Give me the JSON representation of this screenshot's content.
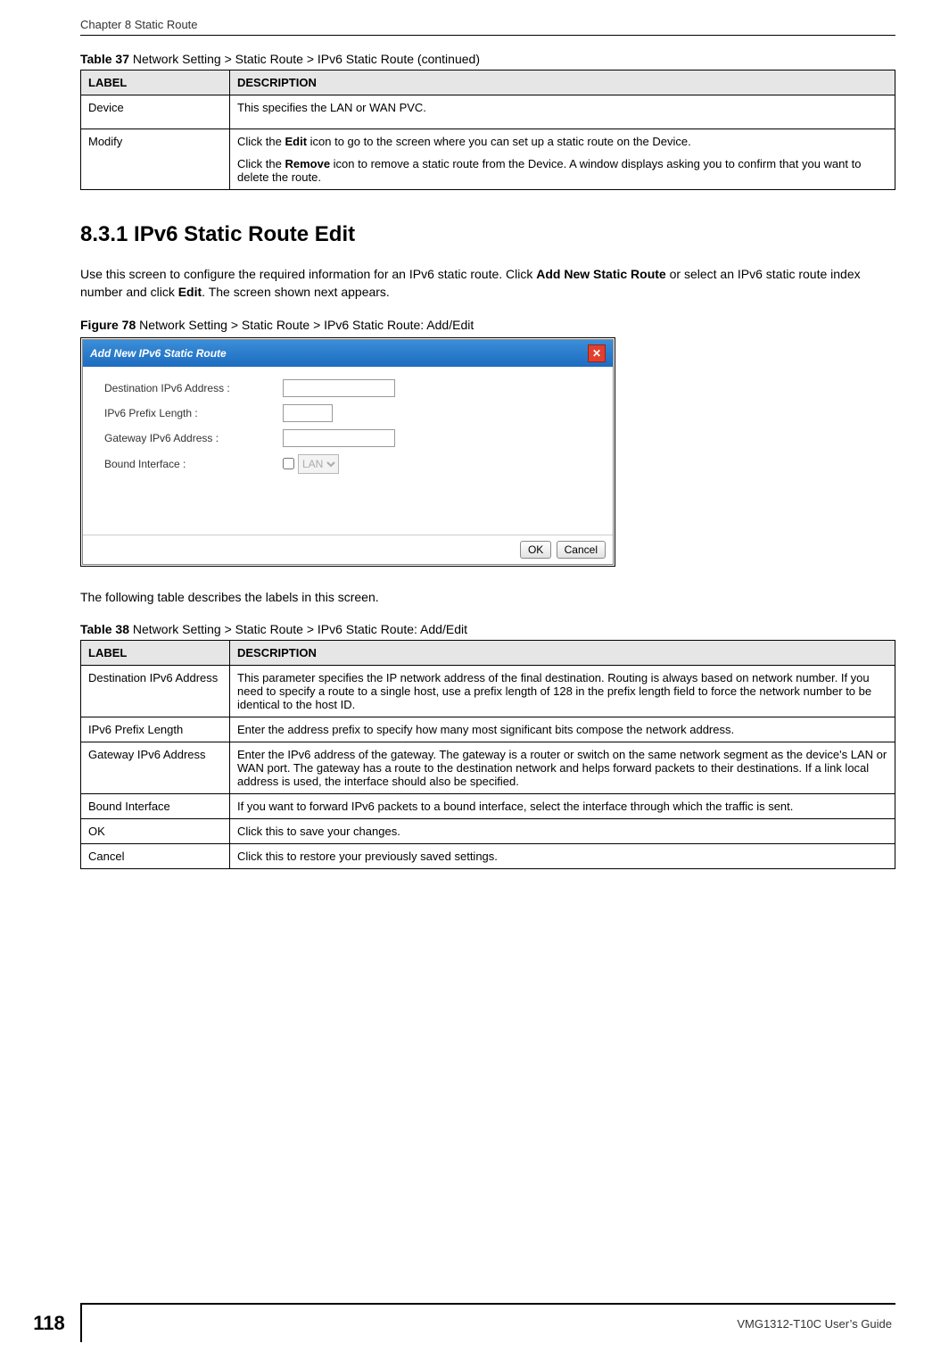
{
  "header": {
    "running": "Chapter 8 Static Route"
  },
  "table37": {
    "caption_prefix": "Table 37",
    "caption_rest": "   Network Setting > Static Route > IPv6 Static Route (continued)",
    "headers": {
      "label": "LABEL",
      "description": "DESCRIPTION"
    },
    "rows": [
      {
        "label": "Device",
        "desc_parts": [
          "This specifies the LAN or WAN PVC."
        ]
      },
      {
        "label": "Modify",
        "desc_parts": [
          "Click the <b>Edit</b> icon to go to the screen where you can set up a static route on the Device.",
          "Click the <b>Remove</b> icon to remove a static route from the Device. A window displays asking you to confirm that you want to delete the route."
        ]
      }
    ]
  },
  "section": {
    "heading": "8.3.1  IPv6 Static Route Edit",
    "intro": "Use this screen to configure the required information for an IPv6 static route. Click <b>Add New Static Route</b> or select an IPv6 static route index number and click <b>Edit</b>. The screen shown next appears.",
    "after_figure": "The following table describes the labels in this screen."
  },
  "figure78": {
    "caption_prefix": "Figure 78",
    "caption_rest": "   Network Setting > Static Route > IPv6 Static Route: Add/Edit",
    "dialog": {
      "title": "Add New IPv6 Static Route",
      "close_glyph": "✕",
      "fields": {
        "dest_label": "Destination IPv6 Address :",
        "prefix_label": "IPv6 Prefix Length :",
        "gateway_label": "Gateway IPv6 Address :",
        "bound_label": "Bound Interface :",
        "bound_option": "LAN"
      },
      "buttons": {
        "ok": "OK",
        "cancel": "Cancel"
      }
    }
  },
  "table38": {
    "caption_prefix": "Table 38",
    "caption_rest": "   Network Setting > Static Route > IPv6 Static Route: Add/Edit",
    "headers": {
      "label": "LABEL",
      "description": "DESCRIPTION"
    },
    "rows": [
      {
        "label": "Destination IPv6 Address",
        "desc": "This parameter specifies the IP network address of the final destination. Routing is always based on network number. If you need to specify a route to a single host, use a prefix length of 128 in the prefix length field to force the network number to be identical to the host ID."
      },
      {
        "label": "IPv6 Prefix Length",
        "desc": "Enter the address prefix to specify how many most significant bits compose the network address."
      },
      {
        "label": "Gateway IPv6 Address",
        "desc": "Enter the IPv6 address of the gateway. The gateway is a router or switch on the same network segment as the device's LAN or WAN port. The gateway has a route to the destination network and helps forward packets to their destinations. If a link local address is used, the interface should also be specified."
      },
      {
        "label": "Bound Interface",
        "desc": "If you want to forward IPv6 packets to a bound interface, select the interface through which the traffic is sent."
      },
      {
        "label": "OK",
        "desc": "Click this to save your changes."
      },
      {
        "label": "Cancel",
        "desc": "Click this to restore your previously saved settings."
      }
    ]
  },
  "footer": {
    "page_number": "118",
    "guide": "VMG1312-T10C User’s Guide"
  }
}
